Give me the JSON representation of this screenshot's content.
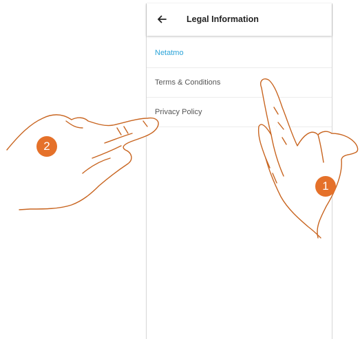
{
  "header": {
    "title": "Legal Information",
    "back_icon": "arrow-left-icon"
  },
  "menu": {
    "items": [
      {
        "label": "Netatmo",
        "active": true
      },
      {
        "label": "Terms & Conditions",
        "active": false
      },
      {
        "label": "Privacy Policy",
        "active": false
      }
    ]
  },
  "annotations": {
    "step_1": "1",
    "step_2": "2"
  },
  "colors": {
    "accent": "#2aa3d8",
    "annotation": "#e5712a",
    "hand_stroke": "#c8641f"
  }
}
